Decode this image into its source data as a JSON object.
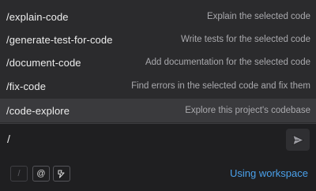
{
  "commands": [
    {
      "name": "/explain-code",
      "description": "Explain the selected code"
    },
    {
      "name": "/generate-test-for-code",
      "description": "Write tests for the selected code"
    },
    {
      "name": "/document-code",
      "description": "Add documentation for the selected code"
    },
    {
      "name": "/fix-code",
      "description": "Find errors in the selected code and fix them"
    },
    {
      "name": "/code-explore",
      "description": "Explore this project's codebase"
    }
  ],
  "selected_command_index": 4,
  "prompt": {
    "value": "/"
  },
  "toolbar": {
    "slash_label": "/",
    "mention_label": "@",
    "context_icon": "lightning-bolt-icon",
    "send_icon": "send-icon"
  },
  "workspace_link": "Using workspace",
  "colors": {
    "accent": "#4aa0ea",
    "selected_row": "#3a3a3d"
  }
}
